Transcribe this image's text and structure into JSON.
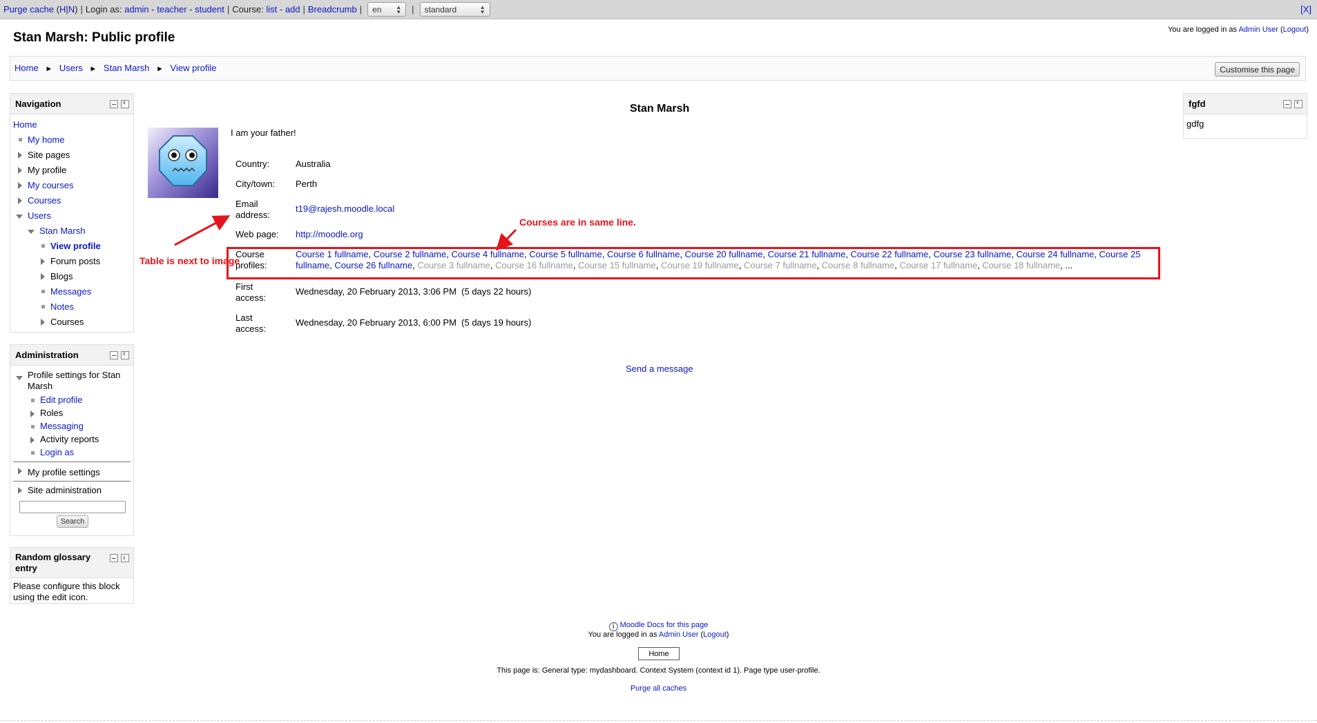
{
  "devbar": {
    "purge_cache": "Purge cache",
    "purge_h": "H",
    "purge_n": "N",
    "login_as_label": "Login as:",
    "admin": "admin",
    "teacher": "teacher",
    "student": "student",
    "course_label": "Course:",
    "list": "list",
    "add": "add",
    "breadcrumb": "Breadcrumb",
    "lang": "en",
    "theme": "standard",
    "close": "[X]"
  },
  "header": {
    "title": "Stan Marsh: Public profile",
    "logged_in_prefix": "You are logged in as",
    "user": "Admin User",
    "logout": "Logout"
  },
  "breadcrumb": [
    "Home",
    "Users",
    "Stan Marsh",
    "View profile"
  ],
  "customise": "Customise this page",
  "navigation": {
    "title": "Navigation",
    "home": "Home",
    "my_home": "My home",
    "site_pages": "Site pages",
    "my_profile": "My profile",
    "my_courses": "My courses",
    "courses": "Courses",
    "users": "Users",
    "stan": "Stan Marsh",
    "view_profile": "View profile",
    "forum_posts": "Forum posts",
    "blogs": "Blogs",
    "messages": "Messages",
    "notes": "Notes",
    "user_courses": "Courses"
  },
  "administration": {
    "title": "Administration",
    "profile_settings_1": "Profile settings for Stan",
    "profile_settings_2": "Marsh",
    "edit_profile": "Edit profile",
    "roles": "Roles",
    "messaging": "Messaging",
    "activity_reports": "Activity reports",
    "login_as": "Login as",
    "my_profile_settings": "My profile settings",
    "site_admin": "Site administration",
    "search_button": "Search"
  },
  "glossary": {
    "title_1": "Random glossary",
    "title_2": "entry",
    "text_1": "Please configure this block",
    "text_2": "using the edit icon."
  },
  "right_block": {
    "title": "fgfd",
    "content": "gdfg"
  },
  "profile": {
    "name": "Stan Marsh",
    "description": "I am your father!",
    "country_label": "Country:",
    "country": "Australia",
    "city_label": "City/town:",
    "city": "Perth",
    "email_label_1": "Email",
    "email_label_2": "address:",
    "email": "t19@rajesh.moodle.local",
    "web_label": "Web page:",
    "web": "http://moodle.org",
    "courses_label_1": "Course",
    "courses_label_2": "profiles:",
    "courses_active": [
      "Course 1 fullname",
      "Course 2 fullname",
      "Course 4 fullname",
      "Course 5 fullname",
      "Course 6 fullname",
      "Course 20 fullname",
      "Course 21 fullname",
      "Course 22 fullname",
      "Course 23 fullname",
      "Course 24 fullname",
      "Course 25 fullname",
      "Course 26 fullname"
    ],
    "courses_dimmed": [
      "Course 3 fullname",
      "Course 16 fullname",
      "Course 15 fullname",
      "Course 19 fullname",
      "Course 7 fullname",
      "Course 8 fullname",
      "Course 17 fullname",
      "Course 18 fullname"
    ],
    "courses_more": "...",
    "first_label_1": "First",
    "first_label_2": "access:",
    "first_access": "Wednesday, 20 February 2013, 3:06 PM  (5 days 22 hours)",
    "last_label_1": "Last",
    "last_label_2": "access:",
    "last_access": "Wednesday, 20 February 2013, 6:00 PM  (5 days 19 hours)",
    "send_message": "Send a message"
  },
  "annotations": {
    "courses_note": "Courses are in same line.",
    "table_note": "Table is next to image",
    "color": "#e6131a"
  },
  "footer": {
    "docs": "Moodle Docs for this page",
    "logged_in_prefix": "You are logged in as",
    "user": "Admin User",
    "logout": "Logout",
    "home_button": "Home",
    "page_info": "This page is: General type: mydashboard. Context System (context id 1). Page type user-profile.",
    "purge_all": "Purge all caches"
  }
}
